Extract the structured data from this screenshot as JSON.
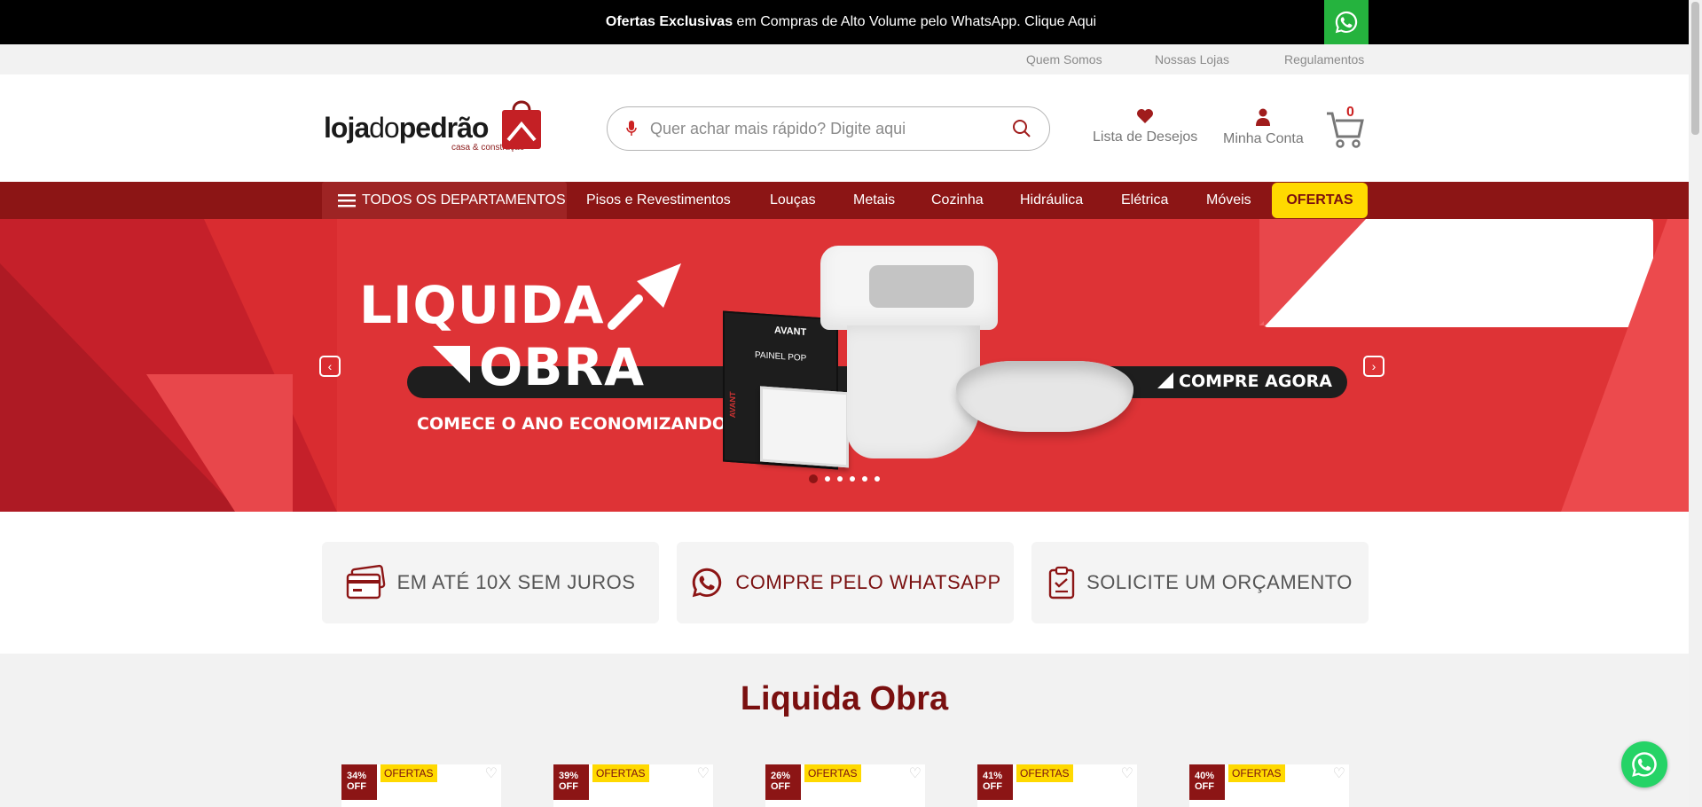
{
  "promo": {
    "bold": "Ofertas Exclusivas",
    "text": " em Compras de Alto Volume pelo WhatsApp. Clique Aqui",
    "icon": "whatsapp-icon"
  },
  "util_links": [
    "Quem Somos",
    "Nossas Lojas",
    "Regulamentos"
  ],
  "logo": {
    "a": "loja",
    "b": "do",
    "c": "pedrão",
    "sub": "casa & construção"
  },
  "search": {
    "placeholder": "Quer achar mais rápido? Digite aqui"
  },
  "header": {
    "wishlist": "Lista de Desejos",
    "account": "Minha Conta",
    "cart_count": "0"
  },
  "nav": {
    "all_departments": "TODOS OS DEPARTAMENTOS",
    "items": [
      "Pisos e Revestimentos",
      "Louças",
      "Metais",
      "Cozinha",
      "Hidráulica",
      "Elétrica",
      "Móveis"
    ],
    "offers": "OFERTAS"
  },
  "hero": {
    "title1": "LIQUIDA",
    "title2": "OBRA",
    "cta": "COMPRE AGORA",
    "subtitle": "COMECE O ANO ECONOMIZANDO!",
    "brand": "AVANT",
    "product_label": "PAINEL POP",
    "slide_count": 6,
    "active_slide": 1
  },
  "features": [
    {
      "label": "EM ATÉ 10X SEM JUROS",
      "icon": "credit-card-icon"
    },
    {
      "label": "COMPRE PELO WHATSAPP",
      "icon": "whatsapp-icon"
    },
    {
      "label": "SOLICITE UM ORÇAMENTO",
      "icon": "clipboard-icon"
    }
  ],
  "section": {
    "title": "Liquida Obra",
    "products": [
      {
        "discount": "34%",
        "off": "OFF",
        "tag": "OFERTAS"
      },
      {
        "discount": "39%",
        "off": "OFF",
        "tag": "OFERTAS"
      },
      {
        "discount": "26%",
        "off": "OFF",
        "tag": "OFERTAS"
      },
      {
        "discount": "41%",
        "off": "OFF",
        "tag": "OFERTAS"
      },
      {
        "discount": "40%",
        "off": "OFF",
        "tag": "OFERTAS"
      }
    ]
  },
  "colors": {
    "brand": "#8c1515",
    "accent": "#ffd900",
    "hero": "#d92c30",
    "whatsapp": "#25d366"
  }
}
